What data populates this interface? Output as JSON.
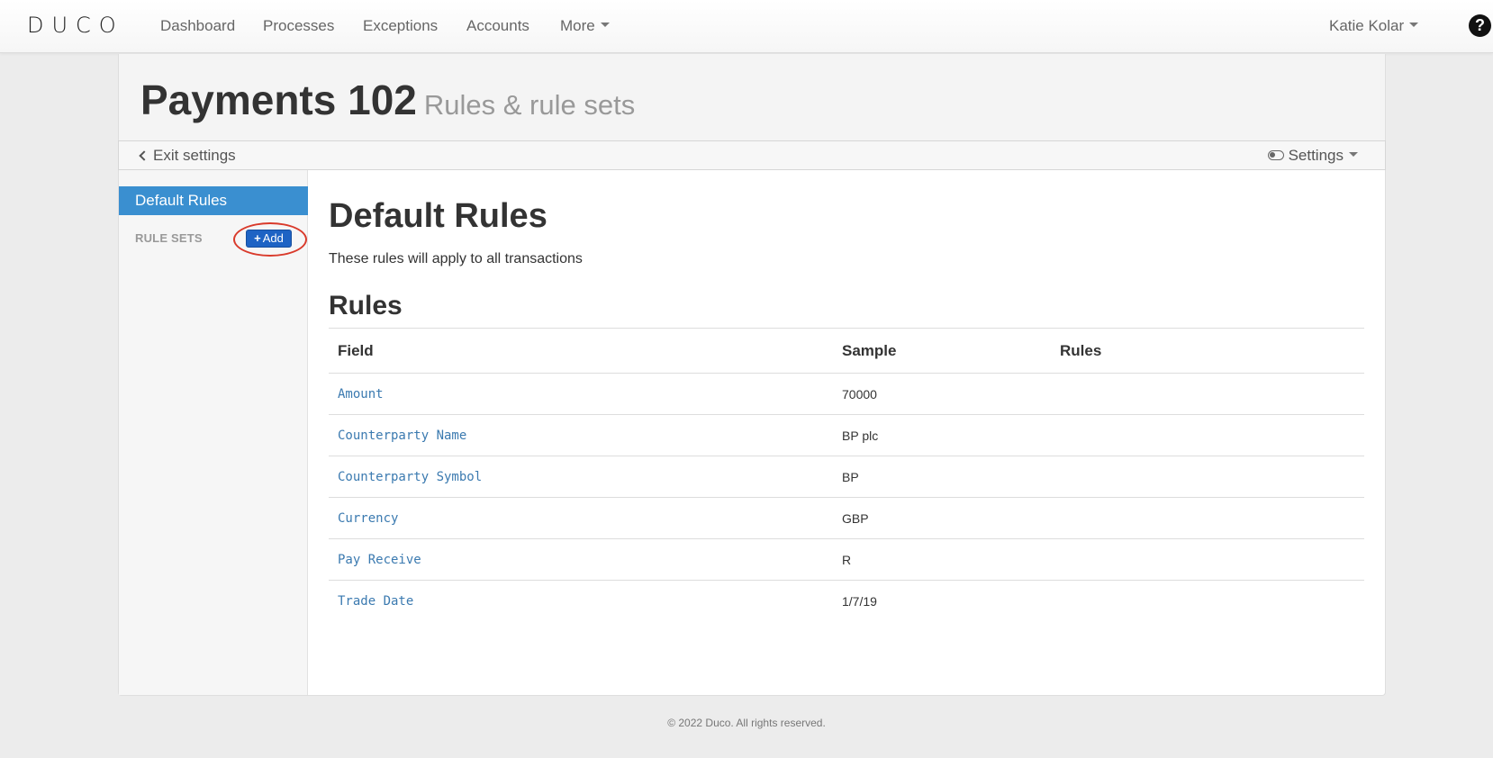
{
  "navbar": {
    "logo": "DUCO",
    "items": [
      {
        "label": "Dashboard"
      },
      {
        "label": "Processes"
      },
      {
        "label": "Exceptions"
      },
      {
        "label": "Accounts"
      },
      {
        "label": "More"
      }
    ],
    "user": "Katie Kolar",
    "help_icon": "?"
  },
  "header": {
    "title": "Payments 102",
    "subtitle": "Rules & rule sets"
  },
  "settings_bar": {
    "exit_label": "Exit settings",
    "settings_label": "Settings"
  },
  "sidebar": {
    "active_item": "Default Rules",
    "rule_sets_label": "RULE SETS",
    "add_label": "Add"
  },
  "main": {
    "title": "Default Rules",
    "description": "These rules will apply to all transactions",
    "rules_heading": "Rules",
    "columns": [
      "Field",
      "Sample",
      "Rules"
    ],
    "rows": [
      {
        "field": "Amount",
        "sample": "70000",
        "rules": ""
      },
      {
        "field": "Counterparty Name",
        "sample": "BP plc",
        "rules": ""
      },
      {
        "field": "Counterparty Symbol",
        "sample": "BP",
        "rules": ""
      },
      {
        "field": "Currency",
        "sample": "GBP",
        "rules": ""
      },
      {
        "field": "Pay Receive",
        "sample": "R",
        "rules": ""
      },
      {
        "field": "Trade Date",
        "sample": "1/7/19",
        "rules": ""
      }
    ]
  },
  "footer": {
    "text": "© 2022 Duco. All rights reserved."
  },
  "colors": {
    "accent": "#3a8fd0",
    "add_button": "#1e63c4",
    "highlight": "#d93a2b",
    "link": "#3b7ab0"
  }
}
